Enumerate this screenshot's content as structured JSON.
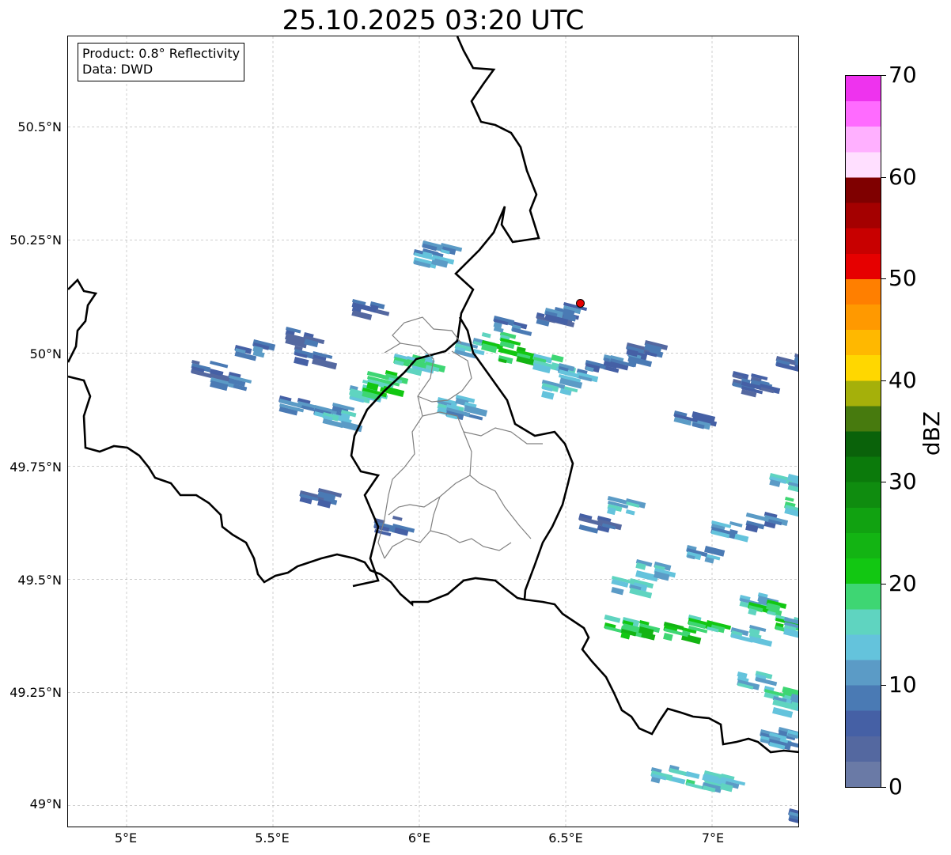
{
  "title": "25.10.2025 03:20 UTC",
  "info": {
    "product": "Product: 0.8° Reflectivity",
    "source": "Data: DWD"
  },
  "axes": {
    "lat_ticks": [
      "50.5°N",
      "50.25°N",
      "50°N",
      "49.75°N",
      "49.5°N",
      "49.25°N",
      "49°N"
    ],
    "lon_ticks": [
      "5°E",
      "5.5°E",
      "6°E",
      "6.5°E",
      "7°E"
    ],
    "lon_range": [
      4.8,
      7.3
    ],
    "lat_range": [
      48.95,
      50.7
    ]
  },
  "radar_site": {
    "lon": 6.55,
    "lat": 50.11,
    "color": "#e60000"
  },
  "colorbar": {
    "label": "dBZ",
    "range": [
      0,
      70
    ],
    "tick_labels": [
      "70",
      "60",
      "50",
      "40",
      "30",
      "20",
      "10",
      "0"
    ],
    "colors": [
      "#6a7aa6",
      "#5468a0",
      "#4560a5",
      "#4a7ab4",
      "#5b9bc6",
      "#64c3dc",
      "#5fd4c0",
      "#3ed673",
      "#12c712",
      "#13b413",
      "#11a211",
      "#0f8c0f",
      "#0b7a0b",
      "#0a620a",
      "#477a0e",
      "#a5b00a",
      "#ffd700",
      "#ffb800",
      "#ff9900",
      "#ff7f00",
      "#e60000",
      "#c80000",
      "#a40000",
      "#7f0000",
      "#ffdfff",
      "#ffb0ff",
      "#ff6bff",
      "#ee33ee"
    ]
  },
  "colors": {
    "border": "#000000",
    "admin_border": "#808080",
    "grid": "#b0b0b0"
  }
}
